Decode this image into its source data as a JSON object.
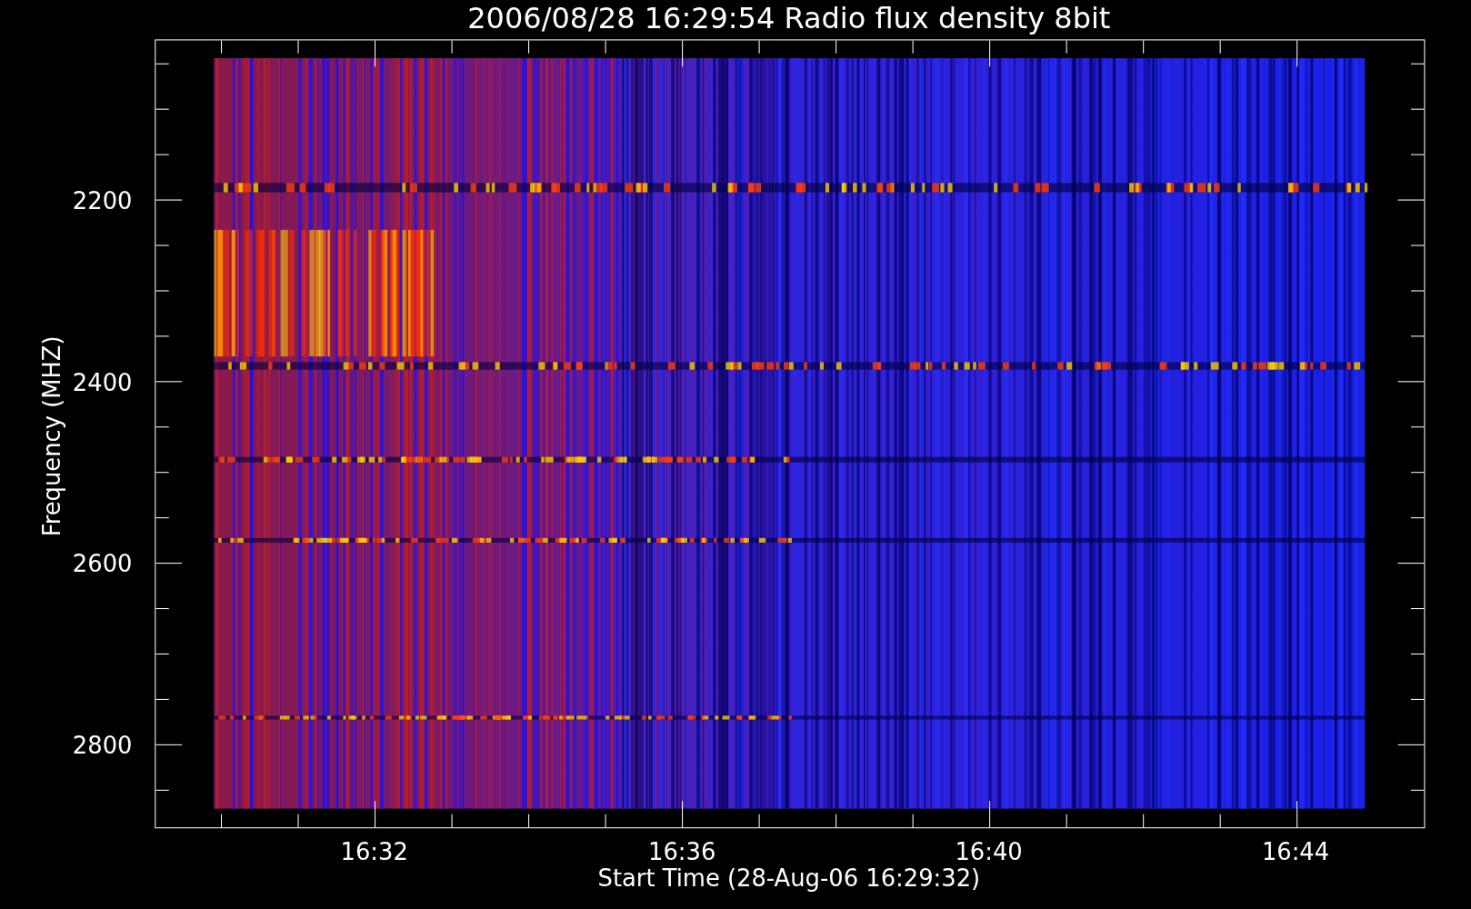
{
  "title": "2006/08/28 16:29:54 Radio flux density 8bit",
  "x_axis": {
    "label": "Start Time (28-Aug-06 16:29:32)",
    "ticks": [
      "16:32",
      "16:36",
      "16:40",
      "16:44"
    ]
  },
  "y_axis": {
    "label": "Frequency (MHZ)",
    "ticks": [
      "2200",
      "2400",
      "2600",
      "2800"
    ]
  }
}
